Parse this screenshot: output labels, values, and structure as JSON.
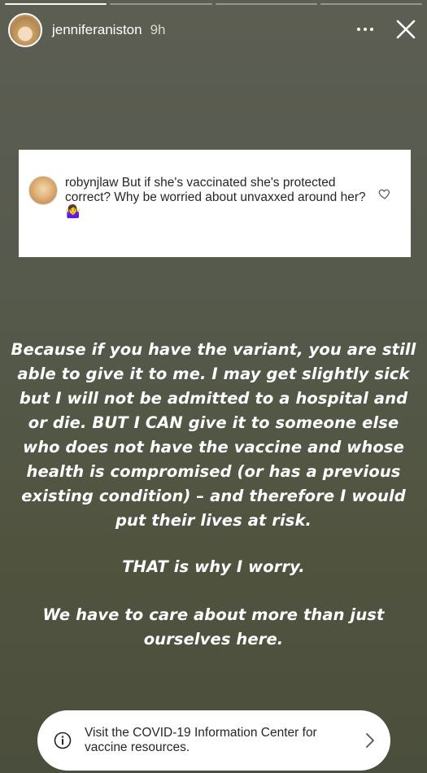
{
  "progress": {
    "segments_total": 4,
    "segments_completed": 1
  },
  "header": {
    "username": "jenniferaniston",
    "time_ago": "9h",
    "icons": {
      "more": "more-horizontal-icon",
      "close": "close-icon"
    }
  },
  "question": {
    "username": "robynjlaw",
    "text": "But if she's vaccinated she's protected correct? Why be worried about unvaxxed around her?",
    "emoji": "🤷‍♀️",
    "icons": {
      "like": "heart-icon"
    }
  },
  "story_text": {
    "paragraph_1": "Because if you have the variant, you are still able to give it to me. I may get slightly sick but I will not be admitted to a hospital and or die. BUT I CAN give it to someone else who does not have the vaccine and whose health is compromised (or has a previous existing condition) – and therefore I would put their lives at risk.",
    "paragraph_2": "THAT is why I worry.",
    "paragraph_3": "We have to care about more than just ourselves here."
  },
  "info_banner": {
    "text": "Visit the COVID-19 Information Center for vaccine resources.",
    "icons": {
      "info": "info-icon",
      "chevron": "chevron-right-icon"
    }
  }
}
